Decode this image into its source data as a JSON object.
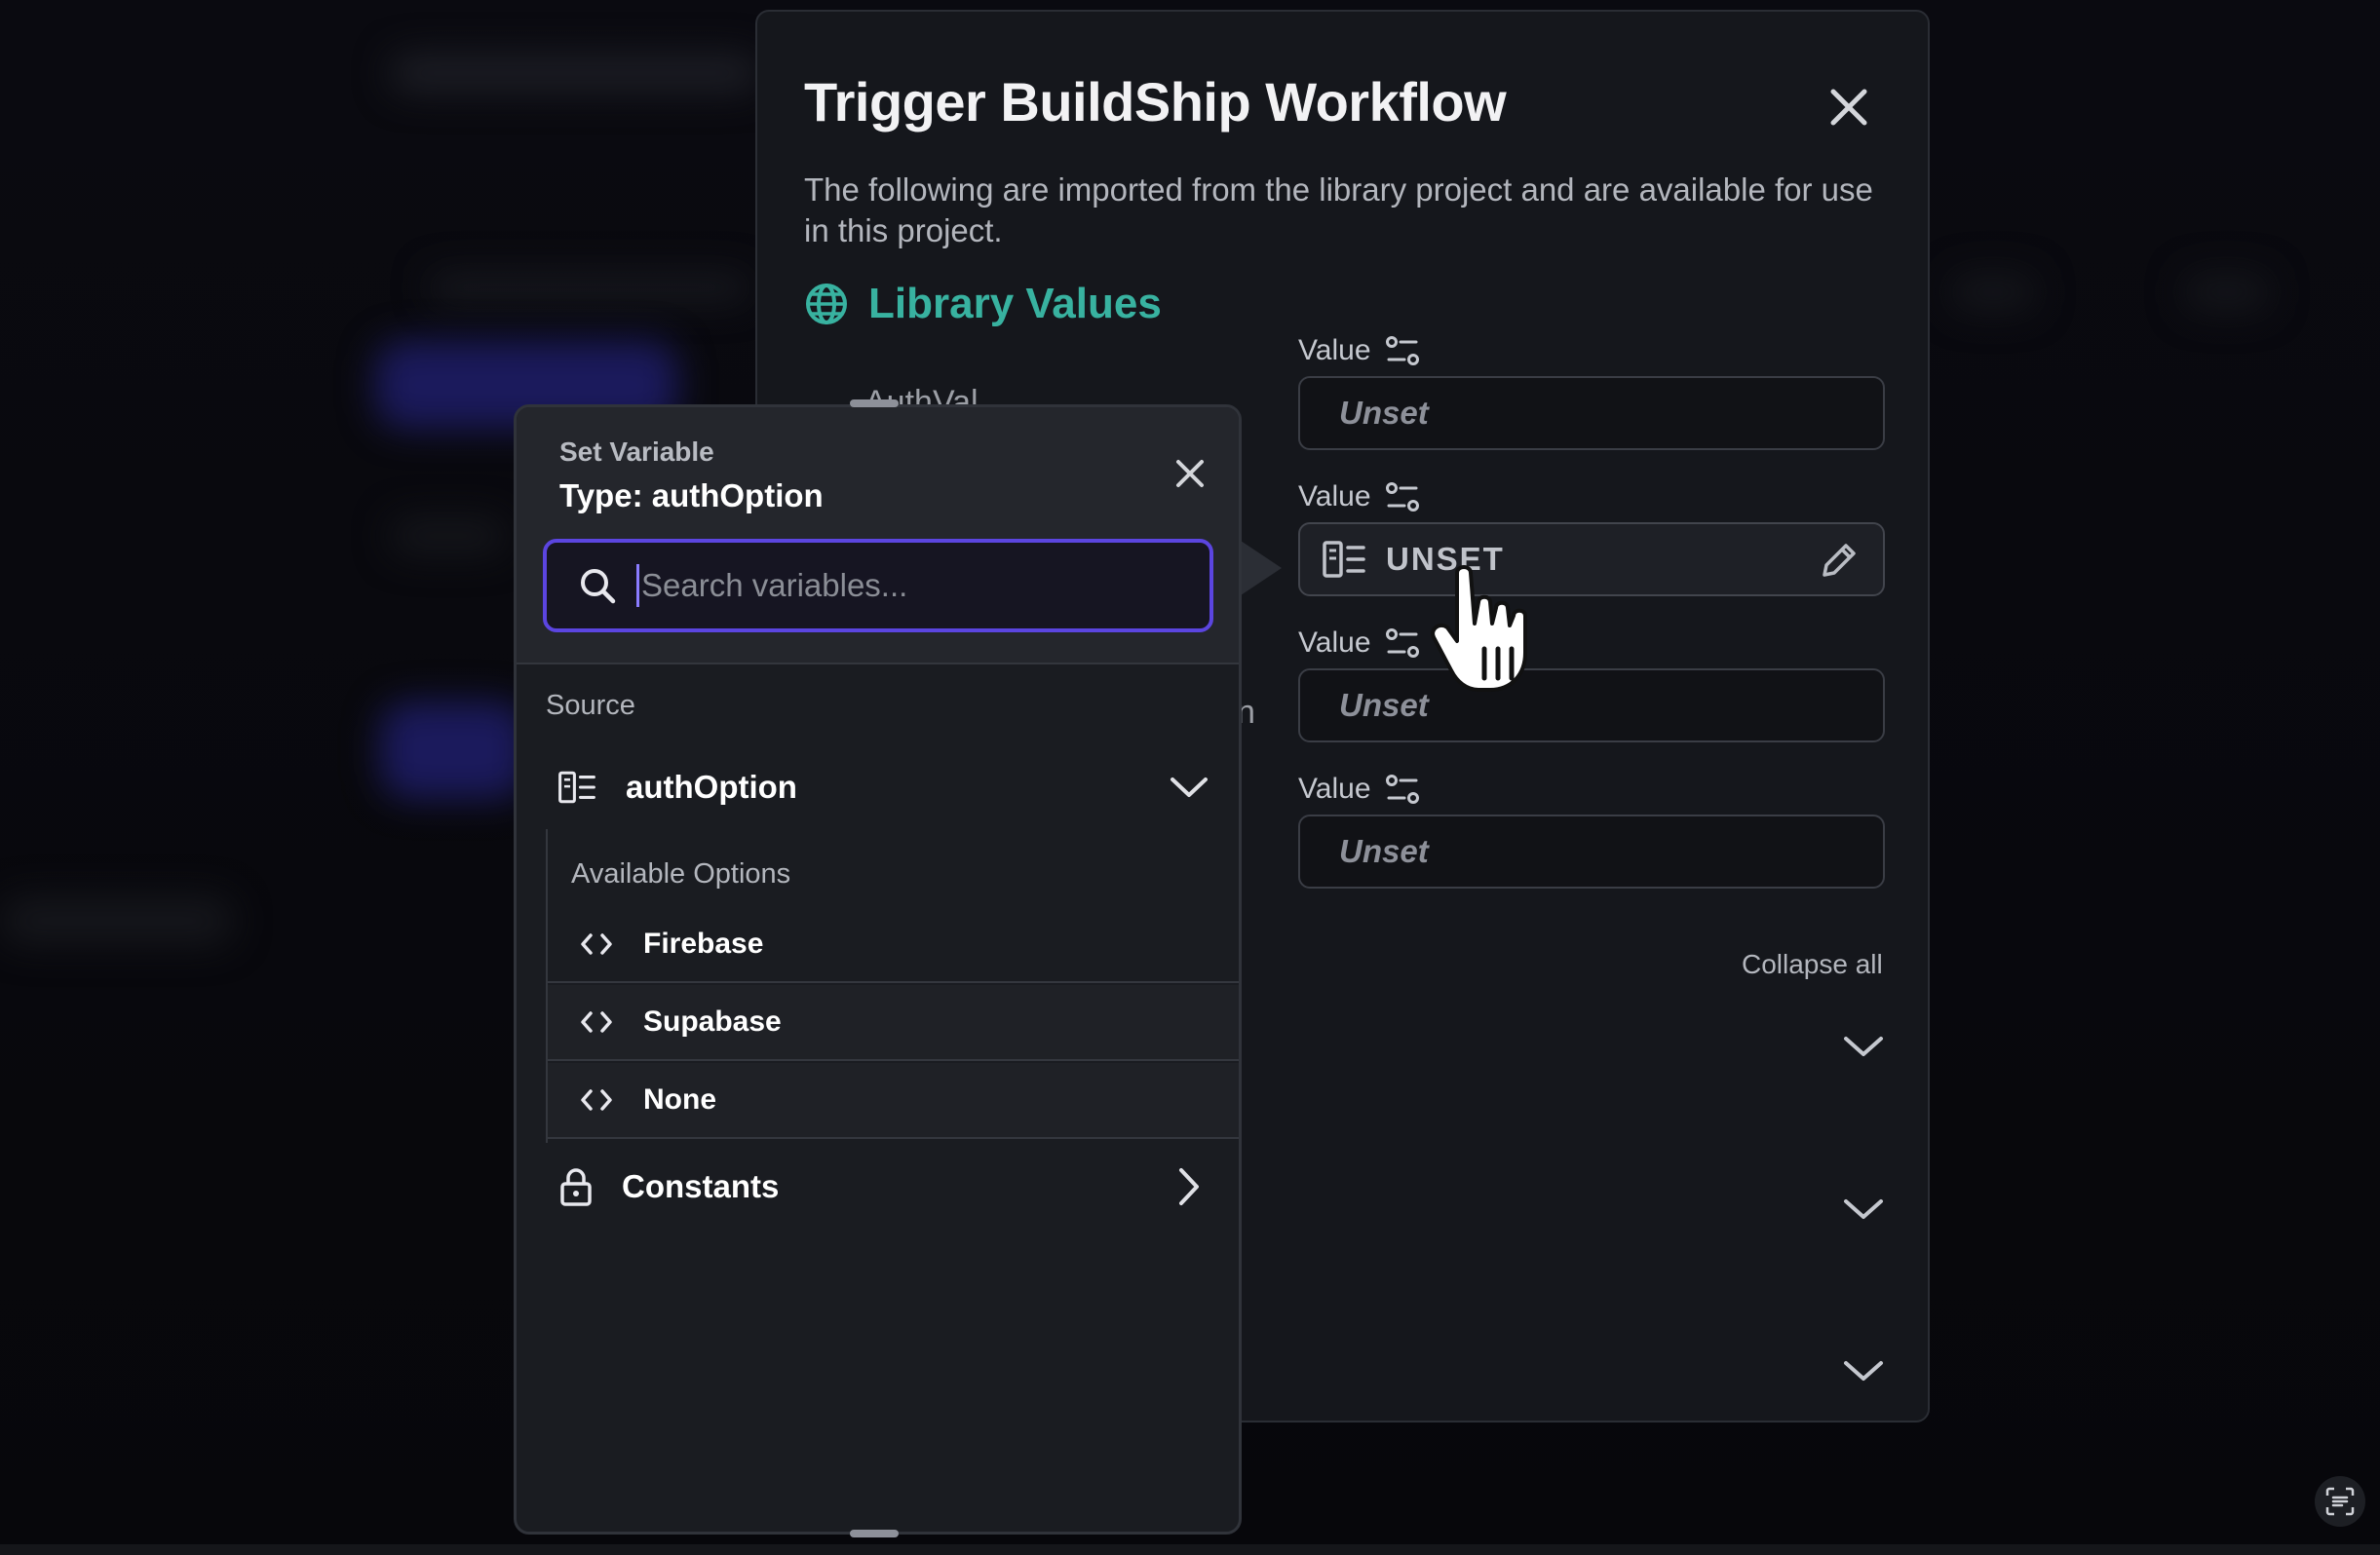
{
  "dialog": {
    "title": "Trigger BuildShip Workflow",
    "description": "The following are imported from the library project and are available for use in this project.",
    "library_values_title": "Library Values",
    "fields": [
      {
        "label": "Value",
        "value": "Unset"
      },
      {
        "label": "Value",
        "value": "UNSET"
      },
      {
        "label": "Value",
        "value": "Unset"
      },
      {
        "label": "Value",
        "value": "Unset"
      }
    ],
    "collapse_all": "Collapse all",
    "partial_label_1": "AuthVal",
    "partial_label_2": "n"
  },
  "popover": {
    "subtitle": "Set Variable",
    "type_label": "Type: authOption",
    "search_placeholder": "Search variables...",
    "source_label": "Source",
    "source_name": "authOption",
    "available_options_label": "Available Options",
    "options": [
      "Firebase",
      "Supabase",
      "None"
    ],
    "constants_label": "Constants"
  },
  "colors": {
    "accent_teal": "#38b2a0",
    "search_border": "#5b45e0"
  }
}
